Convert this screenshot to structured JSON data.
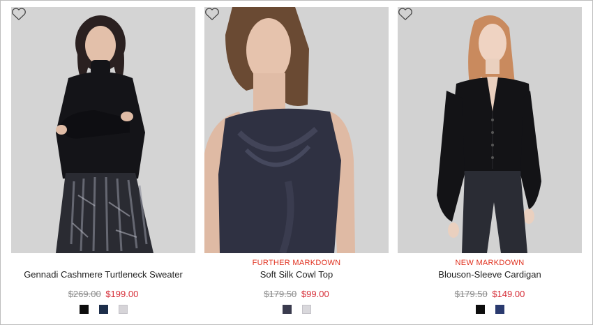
{
  "products": [
    {
      "badge": "",
      "name": "Gennadi Cashmere Turtleneck Sweater",
      "was_price": "$269.00",
      "price": "$199.00",
      "swatches": [
        "#0d0d0d",
        "#1d2e4a",
        "#d6d4d8"
      ]
    },
    {
      "badge": "FURTHER MARKDOWN",
      "name": "Soft Silk Cowl Top",
      "was_price": "$179.50",
      "price": "$99.00",
      "swatches": [
        "#3a3b4e",
        "#d9d8dc"
      ]
    },
    {
      "badge": "NEW MARKDOWN",
      "name": "Blouson-Sleeve Cardigan",
      "was_price": "$179.50",
      "price": "$149.00",
      "swatches": [
        "#0d0d0d",
        "#2a3a6e"
      ]
    }
  ],
  "colors": {
    "badge": "#e0301e",
    "sale_price": "#d62d37",
    "was_price": "#8a8a8a",
    "photo_bg": "#d3d3d3"
  },
  "icons": {
    "favorite": "heart-outline-icon"
  }
}
